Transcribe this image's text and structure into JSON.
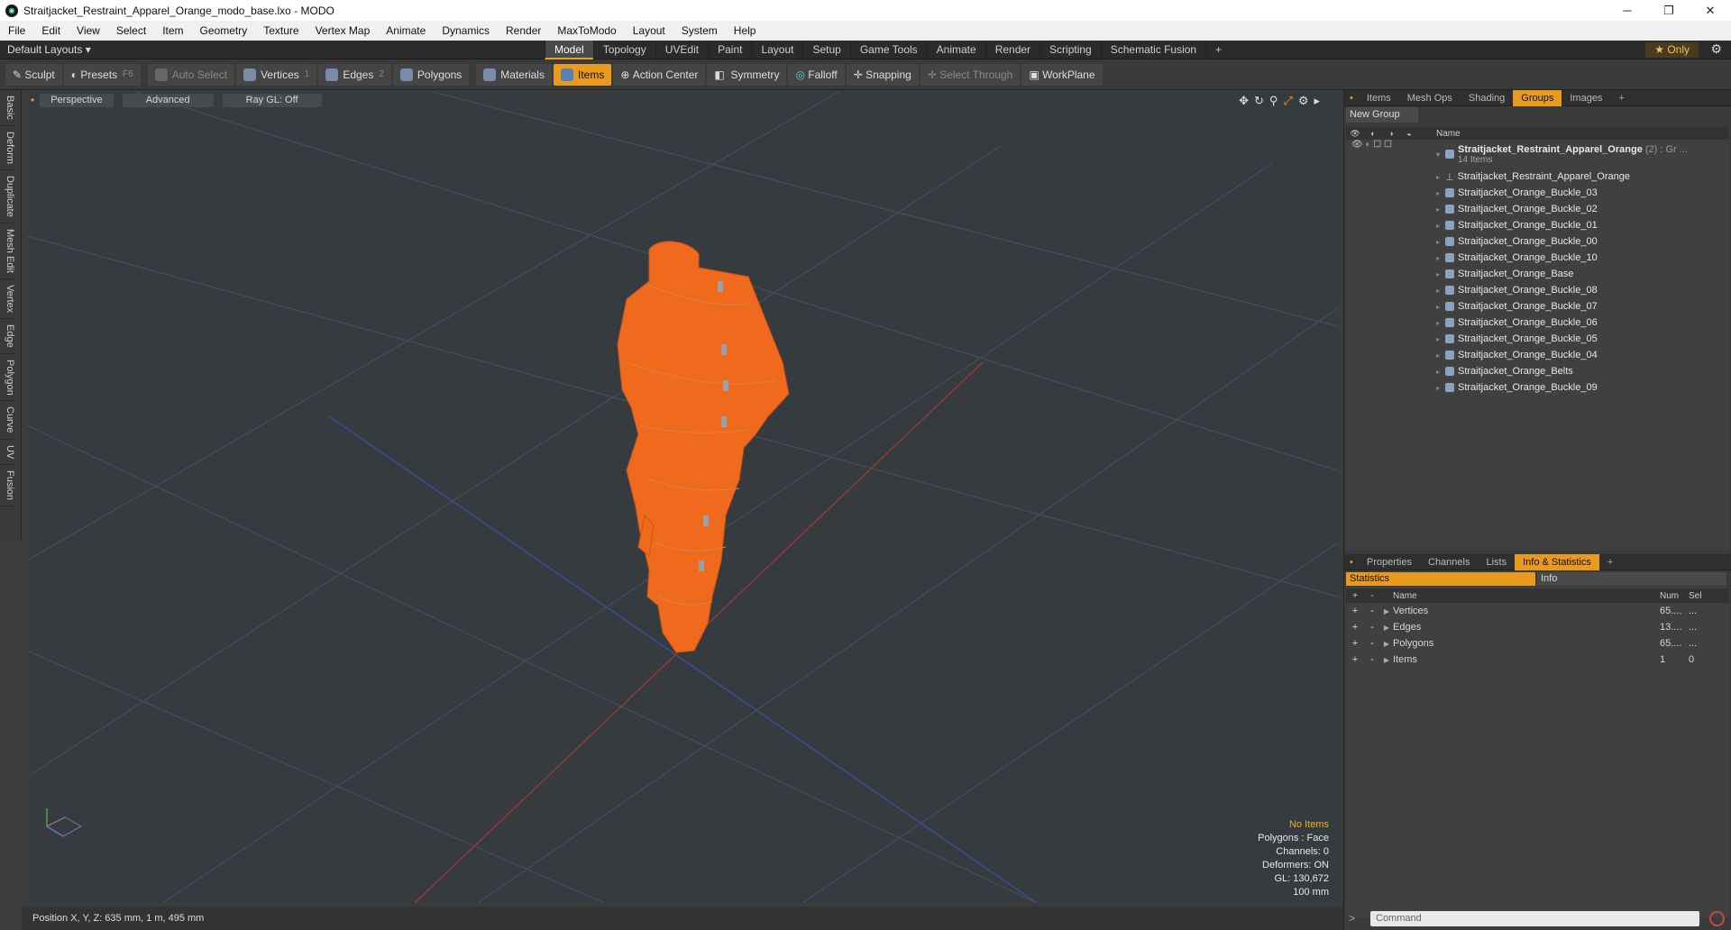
{
  "window": {
    "title": "Straitjacket_Restraint_Apparel_Orange_modo_base.lxo - MODO",
    "min": "─",
    "max": "❐",
    "close": "✕"
  },
  "menu": [
    "File",
    "Edit",
    "View",
    "Select",
    "Item",
    "Geometry",
    "Texture",
    "Vertex Map",
    "Animate",
    "Dynamics",
    "Render",
    "MaxToModo",
    "Layout",
    "System",
    "Help"
  ],
  "layoutbar": {
    "layouts_label": "Default Layouts ▾",
    "tabs": [
      "Model",
      "Topology",
      "UVEdit",
      "Paint",
      "Layout",
      "Setup",
      "Game Tools",
      "Animate",
      "Render",
      "Scripting",
      "Schematic Fusion",
      "+"
    ],
    "active_tab": "Model",
    "only_label": "★ Only",
    "gear": "⚙"
  },
  "toolbar": {
    "sculpt": "Sculpt",
    "presets": "Presets",
    "presets_key": "F6",
    "auto_select": "Auto Select",
    "vertices": "Vertices",
    "vertices_count": "1",
    "edges": "Edges",
    "edges_count": "2",
    "polygons": "Polygons",
    "materials": "Materials",
    "items": "Items",
    "action_center": "Action Center",
    "symmetry": "Symmetry",
    "falloff": "Falloff",
    "snapping": "Snapping",
    "select_through": "Select Through",
    "workplane": "WorkPlane"
  },
  "left_tabs": [
    "Basic",
    "Deform",
    "Duplicate",
    "Mesh Edit",
    "Vertex",
    "Edge",
    "Polygon",
    "Curve",
    "UV",
    "Fusion"
  ],
  "viewport": {
    "perspective": "Perspective",
    "advanced": "Advanced",
    "raygl": "Ray GL: Off",
    "info": {
      "no_items": "No Items",
      "polygons": "Polygons : Face",
      "channels": "Channels: 0",
      "deformers": "Deformers: ON",
      "gl": "GL: 130,672",
      "scale": "100 mm"
    },
    "colors": {
      "model": "#f06a1e",
      "grid": "#4a5055",
      "bg": "#363b40"
    }
  },
  "status": {
    "position": "Position X, Y, Z:  635 mm, 1 m, 495 mm"
  },
  "right_top_tabs": [
    "Items",
    "Mesh Ops",
    "Shading",
    "Groups",
    "Images",
    "+"
  ],
  "right_top_active": "Groups",
  "new_group": "New Group",
  "tree_header": {
    "name": "Name"
  },
  "group": {
    "name": "Straitjacket_Restraint_Apparel_Orange",
    "count": "(2) : Gr ...",
    "sub": "14 Items"
  },
  "items": [
    "Straitjacket_Restraint_Apparel_Orange",
    "Straitjacket_Orange_Buckle_03",
    "Straitjacket_Orange_Buckle_02",
    "Straitjacket_Orange_Buckle_01",
    "Straitjacket_Orange_Buckle_00",
    "Straitjacket_Orange_Buckle_10",
    "Straitjacket_Orange_Base",
    "Straitjacket_Orange_Buckle_08",
    "Straitjacket_Orange_Buckle_07",
    "Straitjacket_Orange_Buckle_06",
    "Straitjacket_Orange_Buckle_05",
    "Straitjacket_Orange_Buckle_04",
    "Straitjacket_Orange_Belts",
    "Straitjacket_Orange_Buckle_09"
  ],
  "right_bottom_tabs": [
    "Properties",
    "Channels",
    "Lists",
    "Info & Statistics",
    "+"
  ],
  "right_bottom_active": "Info & Statistics",
  "stats_tabs": {
    "statistics": "Statistics",
    "info": "Info"
  },
  "stats_header": {
    "name": "Name",
    "num": "Num",
    "sel": "Sel"
  },
  "stats_rows": [
    {
      "name": "Vertices",
      "num": "65....",
      "sel": "..."
    },
    {
      "name": "Edges",
      "num": "13....",
      "sel": "..."
    },
    {
      "name": "Polygons",
      "num": "65....",
      "sel": "..."
    },
    {
      "name": "Items",
      "num": "1",
      "sel": "0"
    }
  ],
  "command": {
    "placeholder": "Command"
  }
}
